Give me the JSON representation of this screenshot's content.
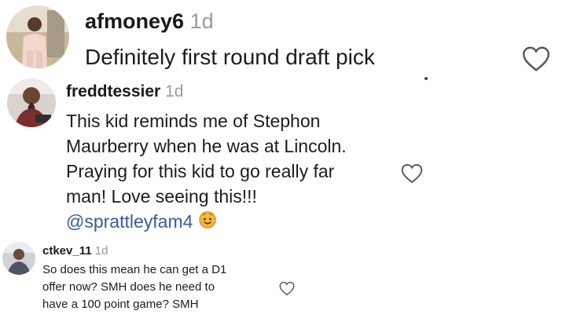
{
  "comments": [
    {
      "username": "afmoney6",
      "timestamp": "1d",
      "lines": [
        "Definitely first round draft pick"
      ],
      "like_icon": "heart-outline-icon"
    },
    {
      "username": "freddtessier",
      "timestamp": "1d",
      "lines": [
        "This kid reminds me of Stephon",
        "Maurberry when he was at Lincoln.",
        "Praying for this kid to go really far",
        "man! Love seeing this!!!"
      ],
      "mention": "@sprattleyfam4",
      "mention_emoji_icon": "smiling-face-emoji-icon",
      "like_icon": "heart-outline-icon"
    },
    {
      "username": "ctkev_11",
      "timestamp": "1d",
      "lines": [
        "So does this mean he can get a D1",
        "offer now? SMH does he need to",
        "have a 100 point game? SMH"
      ],
      "like_icon": "heart-outline-icon"
    }
  ],
  "colors": {
    "text": "#1c1c1c",
    "timestamp": "#9a9a9a",
    "mention": "#3a5ba0",
    "heart_stroke": "#555555"
  }
}
